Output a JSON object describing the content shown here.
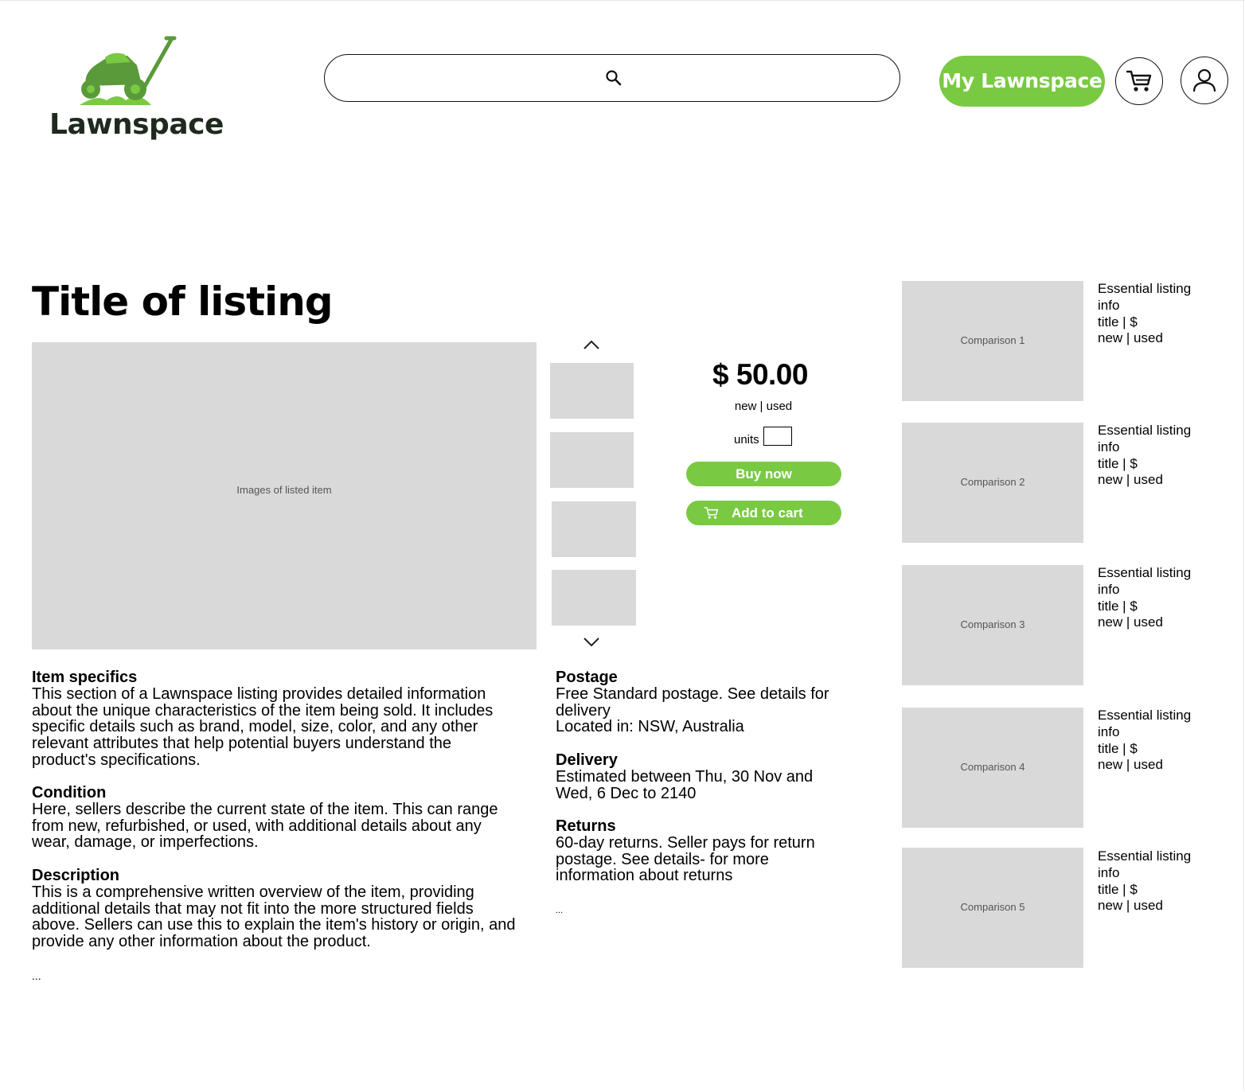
{
  "brand": {
    "name": "Lawnspace",
    "logo_icon": "lawnmower-icon",
    "accent": "#7ac943"
  },
  "header": {
    "search": {
      "placeholder": "",
      "icon": "search-icon"
    },
    "my_button": "My Lawnspace",
    "cart_icon": "cart-icon",
    "account_icon": "user-icon"
  },
  "listing": {
    "title": "Title of listing",
    "image_label": "Images of listed item",
    "price": "$ 50.00",
    "condition": "new | used",
    "units_label": "units",
    "units_value": "",
    "buy_label": "Buy now",
    "add_label": "Add to cart"
  },
  "details": {
    "item_specifics": {
      "heading": "Item specifics",
      "lines": [
        "This section of a Lawnspace listing provides detailed information",
        "about the unique characteristics of the item being sold. It includes",
        "specific details such as brand, model, size, color, and any other",
        "relevant attributes that help potential buyers understand the",
        "product's specifications."
      ]
    },
    "condition": {
      "heading": "Condition",
      "lines": [
        "Here, sellers describe the current state of the item. This can range",
        "from new, refurbished, or used, with additional details about any",
        "wear, damage, or imperfections."
      ]
    },
    "description": {
      "heading": "Description",
      "lines": [
        "This is a comprehensive written overview of the item, providing",
        "additional details that may not fit into the more structured fields",
        "above. Sellers can use this to explain the item's history or origin, and",
        "provide any other information about the product."
      ]
    },
    "more": "..."
  },
  "shipping": {
    "postage": {
      "heading": "Postage",
      "lines": [
        "Free Standard postage. See details for",
        "delivery",
        "Located in: NSW, Australia"
      ]
    },
    "delivery": {
      "heading": "Delivery",
      "lines": [
        "Estimated between Thu, 30 Nov and",
        "Wed, 6 Dec to 2140"
      ]
    },
    "returns": {
      "heading": "Returns",
      "lines": [
        "60-day returns. Seller pays for return",
        "postage. See details- for more",
        "information about returns"
      ]
    },
    "more": "..."
  },
  "comparisons": [
    {
      "label": "Comparison 1",
      "info": [
        "Essential listing",
        "info",
        "title | $",
        "new | used"
      ]
    },
    {
      "label": "Comparison 2",
      "info": [
        "Essential listing",
        "info",
        "title | $",
        "new | used"
      ]
    },
    {
      "label": "Comparison 3",
      "info": [
        "Essential listing",
        "info",
        "title | $",
        "new | used"
      ]
    },
    {
      "label": "Comparison 4",
      "info": [
        "Essential listing",
        "info",
        "title | $",
        "new | used"
      ]
    },
    {
      "label": "Comparison 5",
      "info": [
        "Essential listing",
        "info",
        "title | $",
        "new | used"
      ]
    }
  ]
}
